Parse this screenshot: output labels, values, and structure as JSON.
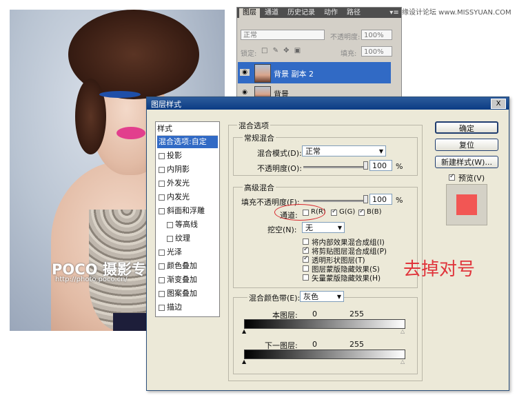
{
  "site_watermark": "思缘设计论坛 www.MISSYUAN.COM",
  "photo": {
    "logo": "POCO 摄影专题",
    "url": "http://photo.poco.cn/"
  },
  "layers_panel": {
    "tabs": [
      "图层",
      "通道",
      "历史记录",
      "动作",
      "路径"
    ],
    "blend_mode": "正常",
    "opacity_label": "不透明度:",
    "opacity_value": "100%",
    "lock_label": "锁定:",
    "fill_label": "填充:",
    "fill_value": "100%",
    "layers": [
      {
        "name": "背景 副本 2",
        "selected": true
      },
      {
        "name": "背景",
        "selected": false
      }
    ]
  },
  "dialog": {
    "title": "图层样式",
    "close_label": "X",
    "styles_header": "样式",
    "style_items": [
      {
        "label": "混合选项:自定",
        "checkbox": false,
        "selected": true,
        "indent": false
      },
      {
        "label": "投影",
        "checkbox": true,
        "selected": false,
        "indent": false
      },
      {
        "label": "内阴影",
        "checkbox": true,
        "selected": false,
        "indent": false
      },
      {
        "label": "外发光",
        "checkbox": true,
        "selected": false,
        "indent": false
      },
      {
        "label": "内发光",
        "checkbox": true,
        "selected": false,
        "indent": false
      },
      {
        "label": "斜面和浮雕",
        "checkbox": true,
        "selected": false,
        "indent": false
      },
      {
        "label": "等高线",
        "checkbox": true,
        "selected": false,
        "indent": true
      },
      {
        "label": "纹理",
        "checkbox": true,
        "selected": false,
        "indent": true
      },
      {
        "label": "光泽",
        "checkbox": true,
        "selected": false,
        "indent": false
      },
      {
        "label": "颜色叠加",
        "checkbox": true,
        "selected": false,
        "indent": false
      },
      {
        "label": "渐变叠加",
        "checkbox": true,
        "selected": false,
        "indent": false
      },
      {
        "label": "图案叠加",
        "checkbox": true,
        "selected": false,
        "indent": false
      },
      {
        "label": "描边",
        "checkbox": true,
        "selected": false,
        "indent": false
      }
    ],
    "blend_options_title": "混合选项",
    "general_blending_title": "常规混合",
    "blend_mode_label": "混合模式(D):",
    "blend_mode_value": "正常",
    "opacity_label": "不透明度(O):",
    "opacity_value": "100",
    "percent": "%",
    "advanced_blending_title": "高级混合",
    "fill_opacity_label": "填充不透明度(F):",
    "fill_opacity_value": "100",
    "channels_label": "通道:",
    "channels": [
      {
        "label": "R(R)",
        "checked": false
      },
      {
        "label": "G(G)",
        "checked": true
      },
      {
        "label": "B(B)",
        "checked": true
      }
    ],
    "knockout_label": "挖空(N):",
    "knockout_value": "无",
    "options": [
      {
        "label": "将内部效果混合成组(I)",
        "checked": false
      },
      {
        "label": "将剪贴图层混合成组(P)",
        "checked": true
      },
      {
        "label": "透明形状图层(T)",
        "checked": true
      },
      {
        "label": "图层蒙版隐藏效果(S)",
        "checked": false
      },
      {
        "label": "矢量蒙版隐藏效果(H)",
        "checked": false
      }
    ],
    "blend_if_label": "混合颜色带(E):",
    "blend_if_value": "灰色",
    "this_layer_label": "本图层:",
    "this_layer_min": "0",
    "this_layer_max": "255",
    "underlying_label": "下一图层:",
    "underlying_min": "0",
    "underlying_max": "255",
    "ok_label": "确定",
    "reset_label": "复位",
    "new_style_label": "新建样式(W)...",
    "preview_label": "预览(V)",
    "preview_checked": true,
    "swatch_color": "#f25654"
  },
  "annotation": "去掉对号",
  "colors": {
    "accent": "#316ac5",
    "annotation": "#e0343b"
  }
}
